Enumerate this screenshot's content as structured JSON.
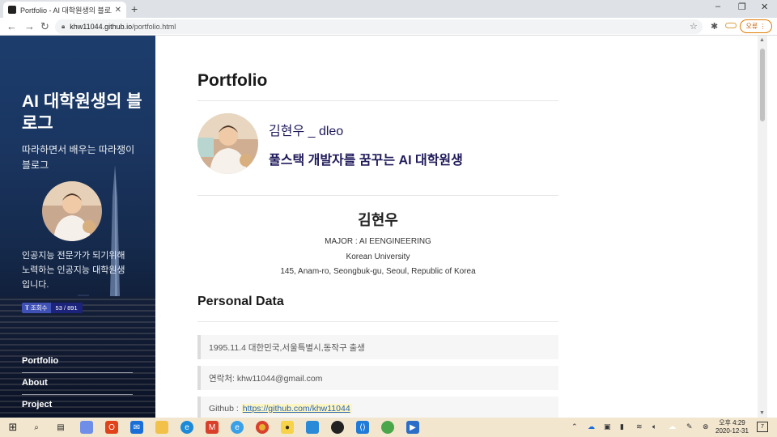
{
  "browser": {
    "tab_title": "Portfolio - AI 대학원생의 블로그",
    "tab_close": "✕",
    "new_tab": "+",
    "url_host": "khw11044.github.io",
    "url_path": "/portfolio.html",
    "error_button": "오류",
    "window_controls": [
      "–",
      "❐",
      "✕"
    ]
  },
  "sidebar": {
    "title": "AI 대학원생의 블로그",
    "description": "따라하면서 배우는 따라쟁이 블로그",
    "intro": "인공지능 전문가가 되기위해 노력하는 인공지능 대학원생 입니다.",
    "hits_label": "조회수",
    "hits_value": "53 / 891",
    "nav": [
      {
        "label": "Portfolio"
      },
      {
        "label": "About"
      },
      {
        "label": "Project"
      }
    ]
  },
  "main": {
    "page_title": "Portfolio",
    "profile_name": "김현우 _ dleo",
    "profile_tagline": "풀스택 개발자를 꿈꾸는 AI 대학원생",
    "name": "김현우",
    "major": "MAJOR : AI EENGINEERING",
    "university": "Korean University",
    "address": "145, Anam-ro, Seongbuk-gu, Seoul, Republic of Korea",
    "section_title": "Personal Data",
    "personal": [
      {
        "text": "1995.11.4 대한민국,서울특별시,동작구 출생"
      },
      {
        "text": "연락처: khw11044@gmail.com"
      },
      {
        "text": "Github :",
        "link": "https://github.com/khw11044"
      }
    ]
  },
  "taskbar": {
    "time": "오후 4:29",
    "date": "2020-12-31",
    "notification_count": "7"
  },
  "colors": {
    "accent_text": "#1f1a5a",
    "sidebar_bg": "#1a3560",
    "link": "#2a64b6",
    "taskbar": "#f3e6cf"
  }
}
